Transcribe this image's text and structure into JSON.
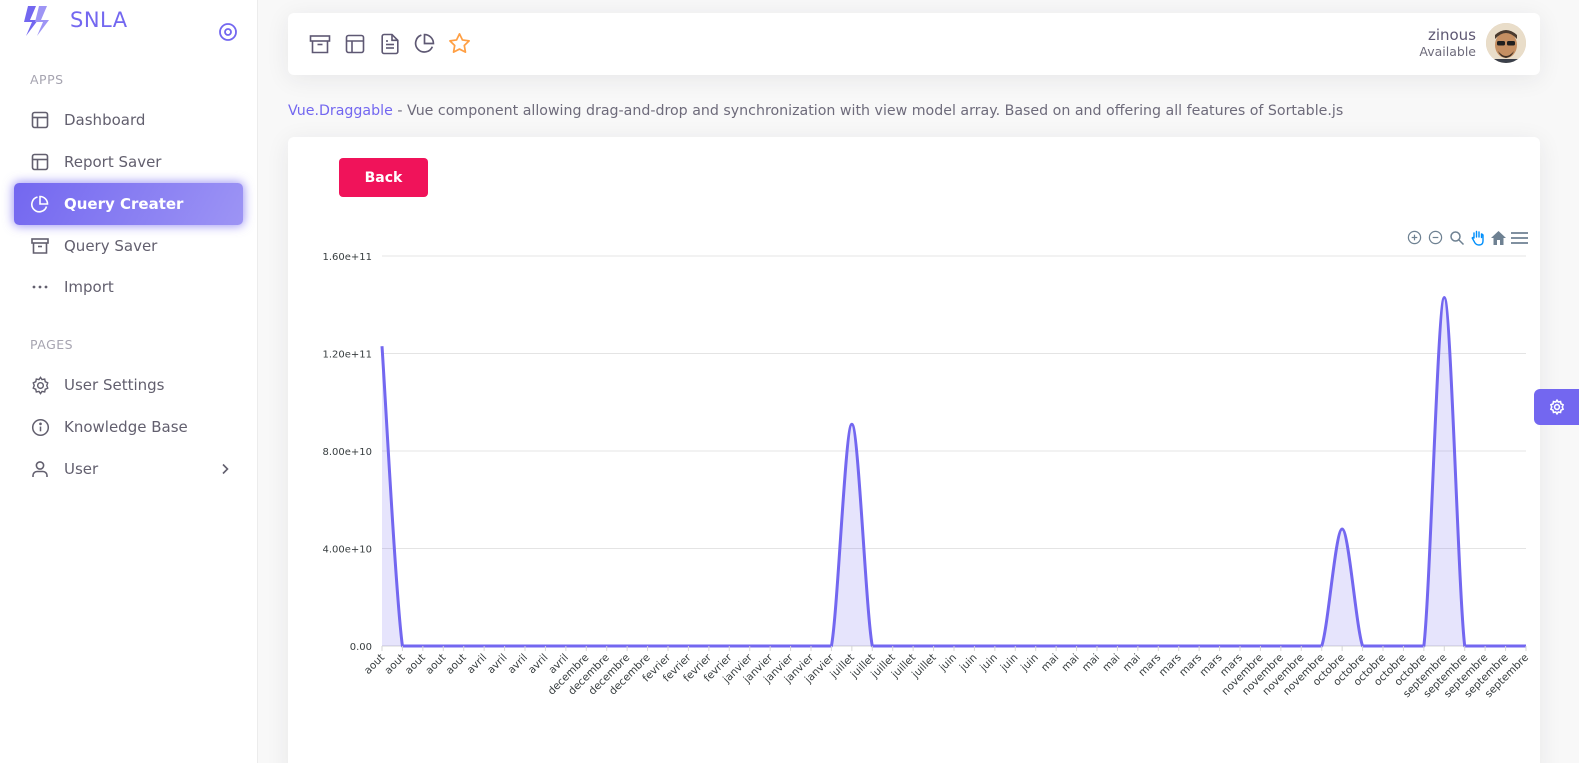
{
  "brand": {
    "name": "SNLA",
    "color": "#7367f0"
  },
  "sidebar": {
    "sections": [
      {
        "title": "APPS"
      },
      {
        "title": "PAGES"
      }
    ],
    "apps": [
      {
        "label": "Dashboard",
        "icon": "layout-icon"
      },
      {
        "label": "Report Saver",
        "icon": "layout-icon"
      },
      {
        "label": "Query Creater",
        "icon": "pie-chart-icon",
        "active": true
      },
      {
        "label": "Query Saver",
        "icon": "archive-icon"
      },
      {
        "label": "Import",
        "icon": "more-horizontal-icon"
      }
    ],
    "pages": [
      {
        "label": "User Settings",
        "icon": "settings-icon"
      },
      {
        "label": "Knowledge Base",
        "icon": "info-icon"
      },
      {
        "label": "User",
        "icon": "user-icon"
      }
    ]
  },
  "navbar": {
    "icons": [
      "archive-icon",
      "layout-icon",
      "file-text-icon",
      "pie-chart-icon",
      "star-icon"
    ],
    "user": {
      "name": "zinous",
      "status": "Available"
    }
  },
  "description": {
    "link": "Vue.Draggable",
    "text": " - Vue component allowing drag-and-drop and synchronization with view model array. Based on and offering all features of Sortable.js"
  },
  "card": {
    "back_label": "Back",
    "back_color": "#f0135a"
  },
  "chart_data": {
    "type": "area",
    "title": "",
    "xlabel": "",
    "ylabel": "",
    "ylim": [
      0,
      160000000000
    ],
    "yticks": [
      "0.00",
      "4.00e+10",
      "8.00e+10",
      "1.20e+11",
      "1.60e+11"
    ],
    "grid": true,
    "color": "#7367f0",
    "categories": [
      "aout",
      "aout",
      "aout",
      "aout",
      "aout",
      "avril",
      "avril",
      "avril",
      "avril",
      "avril",
      "decembre",
      "decembre",
      "decembre",
      "decembre",
      "fevrier",
      "fevrier",
      "fevrier",
      "fevrier",
      "janvier",
      "janvier",
      "janvier",
      "janvier",
      "janvier",
      "juillet",
      "juillet",
      "juillet",
      "juillet",
      "juillet",
      "juin",
      "juin",
      "juin",
      "juin",
      "juin",
      "mai",
      "mai",
      "mai",
      "mai",
      "mai",
      "mars",
      "mars",
      "mars",
      "mars",
      "mars",
      "novembre",
      "novembre",
      "novembre",
      "novembre",
      "octobre",
      "octobre",
      "octobre",
      "octobre",
      "octobre",
      "septembre",
      "septembre",
      "septembre",
      "septembre",
      "septembre"
    ],
    "series": [
      {
        "values": [
          123000000000,
          0,
          0,
          0,
          0,
          0,
          0,
          0,
          0,
          0,
          0,
          0,
          0,
          0,
          0,
          0,
          0,
          0,
          0,
          0,
          0,
          0,
          0,
          91000000000,
          0,
          0,
          0,
          0,
          0,
          0,
          0,
          0,
          0,
          0,
          0,
          0,
          0,
          0,
          0,
          0,
          0,
          0,
          0,
          0,
          0,
          0,
          0,
          48000000000,
          0,
          0,
          0,
          0,
          143000000000,
          0,
          0,
          0,
          0
        ]
      }
    ],
    "toolbar_icons": [
      "zoom-in-icon",
      "zoom-out-icon",
      "zoom-select-icon",
      "pan-icon",
      "home-icon",
      "menu-icon"
    ]
  }
}
